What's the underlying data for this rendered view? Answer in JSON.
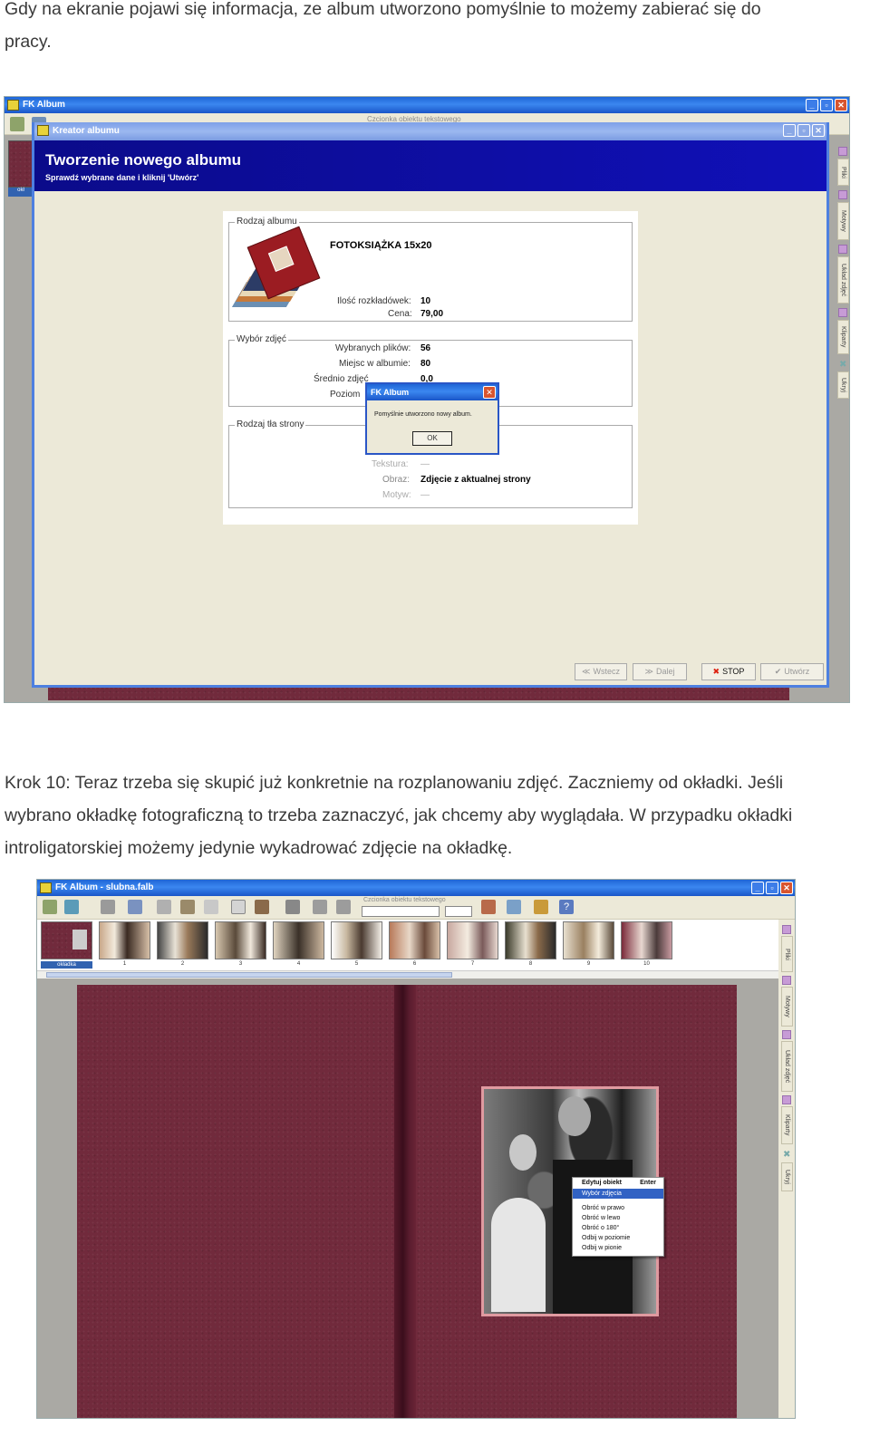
{
  "intro": {
    "line1": "Gdy na ekranie pojawi się informacja, ze album utworzono pomyślnie to możemy zabierać się do",
    "line2": "pracy."
  },
  "screenshot1": {
    "app_title": "FK Album",
    "toolbar_hint": "Czcionka obiektu tekstowego",
    "wizard_title": "Kreator albumu",
    "banner_title": "Tworzenie nowego albumu",
    "banner_subtitle": "Sprawdź wybrane dane i kliknij 'Utwórz'",
    "album_type": {
      "legend": "Rodzaj albumu",
      "name": "FOTOKSIĄŻKA 15x20",
      "spreads_label": "Ilość rozkładówek:",
      "spreads_value": "10",
      "price_label": "Cena:",
      "price_value": "79,00"
    },
    "photo_selection": {
      "legend": "Wybór zdjęć",
      "selected_label": "Wybranych plików:",
      "selected_value": "56",
      "places_label": "Miejsc w albumie:",
      "places_value": "80",
      "avg_label": "Średnio zdjęć",
      "avg_value": "0,0",
      "level_label": "Poziom"
    },
    "background": {
      "legend": "Rodzaj tła strony",
      "texture_label": "Tekstura:",
      "texture_value": "—",
      "image_label": "Obraz:",
      "image_value": "Zdjęcie z aktualnej strony",
      "motif_label": "Motyw:",
      "motif_value": "—"
    },
    "dialog": {
      "title": "FK Album",
      "message": "Pomyślnie utworzono nowy album.",
      "ok": "OK"
    },
    "buttons": {
      "back": "Wstecz",
      "next": "Dalej",
      "stop": "STOP",
      "create": "Utwórz"
    },
    "side_tabs": [
      "Pliki",
      "Motywy",
      "Układ zdjęć",
      "Kliparty",
      "Ukryj"
    ],
    "cover_label": "okł"
  },
  "step10": {
    "line1": "Krok 10:  Teraz trzeba się skupić już konkretnie na rozplanowaniu zdjęć. Zaczniemy od okładki. Jeśli",
    "line2": "wybrano okładkę fotograficzną to trzeba zaznaczyć, jak chcemy aby wyglądała. W przypadku okładki",
    "line3": "introligatorskiej możemy jedynie wykadrować zdjęcie na okładkę."
  },
  "screenshot2": {
    "app_title": "FK Album - slubna.falb",
    "toolbar_hint": "Czcionka obiektu tekstowego",
    "thumb_labels": [
      "okładka",
      "1",
      "2",
      "3",
      "4",
      "5",
      "6",
      "7",
      "8",
      "9",
      "10"
    ],
    "side_tabs": [
      "Pliki",
      "Motywy",
      "Układ zdjęć",
      "Kliparty",
      "Ukryj"
    ],
    "context_menu": {
      "header_label": "Edytuj obiekt",
      "header_shortcut": "Enter",
      "selected": "Wybór zdjęcia",
      "items": [
        "Obróć w prawo",
        "Obróć w lewo",
        "Obróć o 180°",
        "Odbij w poziomie",
        "Odbij w pionie"
      ]
    }
  }
}
